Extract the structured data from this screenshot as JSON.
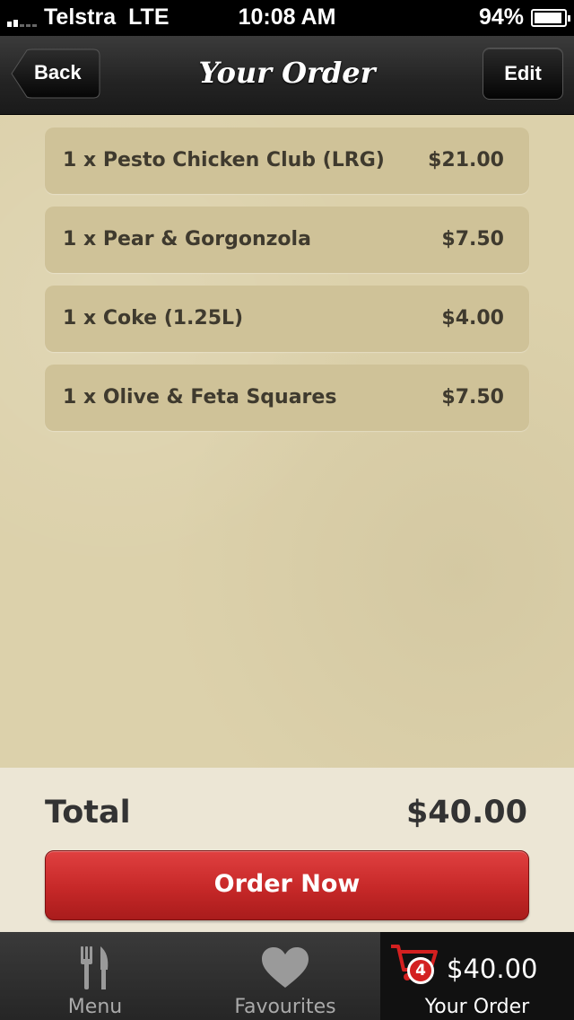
{
  "status_bar": {
    "carrier": "Telstra",
    "network": "LTE",
    "time": "10:08 AM",
    "battery": "94%",
    "battery_level": 0.94
  },
  "nav": {
    "title": "Your Order",
    "back_label": "Back",
    "edit_label": "Edit"
  },
  "order": {
    "items": [
      {
        "name": "1 x Pesto Chicken Club (LRG)",
        "price": "$21.00"
      },
      {
        "name": "1 x Pear & Gorgonzola",
        "price": "$7.50"
      },
      {
        "name": "1 x Coke (1.25L)",
        "price": "$4.00"
      },
      {
        "name": "1 x Olive & Feta Squares",
        "price": "$7.50"
      }
    ],
    "total_label": "Total",
    "total_value": "$40.00",
    "order_button_label": "Order Now"
  },
  "tab_bar": {
    "tabs": [
      {
        "label": "Menu",
        "icon": "fork-knife-icon"
      },
      {
        "label": "Favourites",
        "icon": "heart-icon"
      },
      {
        "label": "Your Order",
        "icon": "cart-icon",
        "badge": "4",
        "amount": "$40.00"
      }
    ]
  },
  "colors": {
    "accent_red": "#c62828",
    "paper": "#dcd1ab",
    "item_bg": "#cfc298"
  }
}
